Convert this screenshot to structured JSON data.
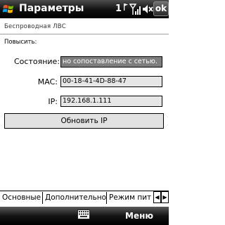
{
  "titlebar": {
    "title": "Параметры",
    "notification_count": "1",
    "ok_label": "ok"
  },
  "page": {
    "section_title": "Беспроводная ЛВС",
    "connect_label": "Повысить:"
  },
  "fields": {
    "status_label": "Состояние:",
    "status_value": "но сопоставление с сетью.",
    "mac_label": "MAC:",
    "mac_value": "00-18-41-4D-88-47",
    "ip_label": "IP:",
    "ip_value": "192.168.1.111"
  },
  "renew_button": "Обновить IP",
  "tabs": [
    "Основные",
    "Дополнительно",
    "Режим пит"
  ],
  "tab_arrows": {
    "left": "◀",
    "right": "▶"
  },
  "softkeys": {
    "right": "Меню"
  },
  "icons": {
    "start": "windows-flag-icon",
    "signal": "signal-strength-icon",
    "volume": "volume-muted-icon",
    "keyboard": "keyboard-icon"
  }
}
